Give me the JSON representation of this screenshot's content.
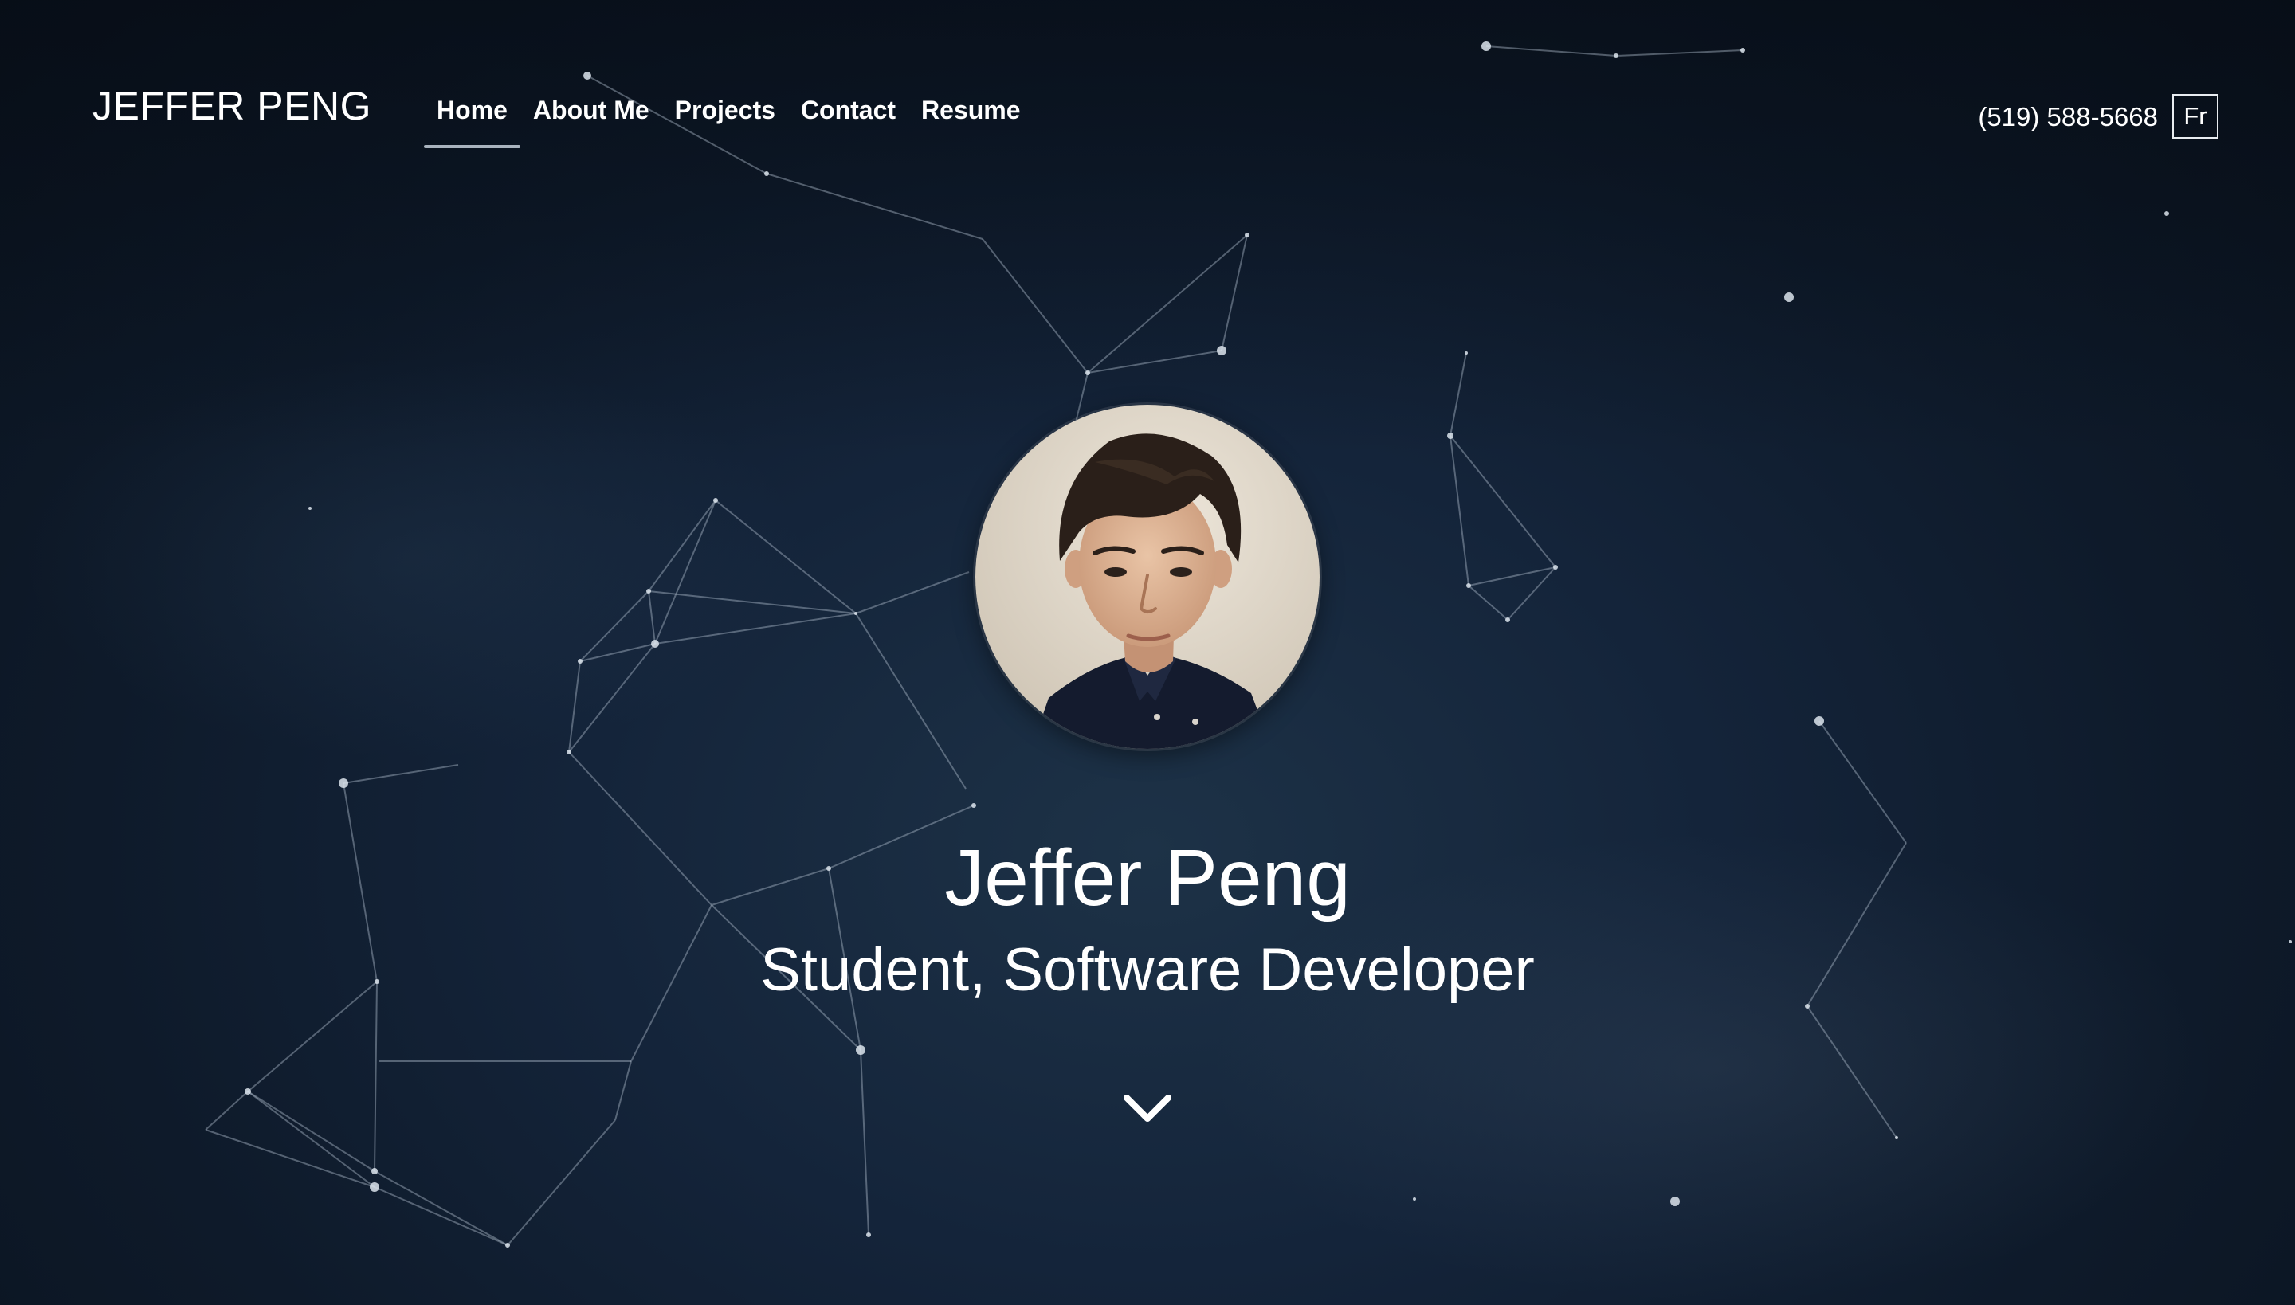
{
  "header": {
    "brand": "JEFFER PENG",
    "nav": [
      "Home",
      "About Me",
      "Projects",
      "Contact",
      "Resume"
    ],
    "active_nav": "Home",
    "phone": "(519) 588-5668",
    "language_toggle": "Fr"
  },
  "hero": {
    "name": "Jeffer Peng",
    "role": "Student, Software Developer",
    "avatar_icon": "profile-photo",
    "scroll_icon": "chevron-down-icon"
  },
  "colors": {
    "background_top": "#0a121d",
    "background_center": "#1d3247",
    "text": "#ffffff",
    "active_underline": "#a9b3be",
    "network_lines": "#8c9aaa"
  }
}
